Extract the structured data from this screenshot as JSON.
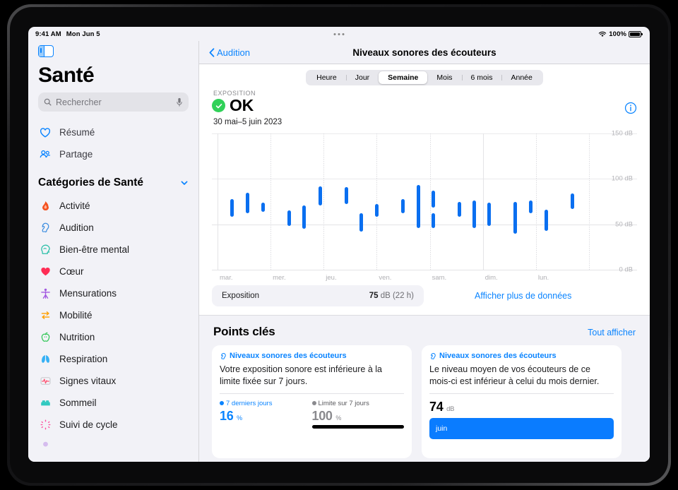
{
  "status_bar": {
    "time": "9:41 AM",
    "date": "Mon Jun 5",
    "battery_percent": "100%",
    "wifi_icon": "wifi-icon",
    "battery_icon": "battery-icon"
  },
  "sidebar": {
    "toggle_icon": "sidebar-toggle-icon",
    "app_title": "Santé",
    "search": {
      "placeholder": "Rechercher",
      "value": "",
      "search_icon": "search-icon",
      "mic_icon": "microphone-icon"
    },
    "top_items": [
      {
        "label": "Résumé",
        "icon": "heart-outline-icon",
        "color": "#0a84ff"
      },
      {
        "label": "Partage",
        "icon": "people-icon",
        "color": "#0a84ff"
      }
    ],
    "section": {
      "label": "Catégories de Santé",
      "chevron_icon": "chevron-down-icon"
    },
    "categories": [
      {
        "label": "Activité",
        "icon": "flame-icon",
        "color": "#f4511e"
      },
      {
        "label": "Audition",
        "icon": "ear-icon",
        "color": "#3f8fe0"
      },
      {
        "label": "Bien-être mental",
        "icon": "head-icon",
        "color": "#2bbfa8"
      },
      {
        "label": "Cœur",
        "icon": "heart-filled-icon",
        "color": "#ff2d55"
      },
      {
        "label": "Mensurations",
        "icon": "body-icon",
        "color": "#a259e0"
      },
      {
        "label": "Mobilité",
        "icon": "arrows-icon",
        "color": "#ffa000"
      },
      {
        "label": "Nutrition",
        "icon": "apple-icon",
        "color": "#34c759"
      },
      {
        "label": "Respiration",
        "icon": "lungs-icon",
        "color": "#35b0f5"
      },
      {
        "label": "Signes vitaux",
        "icon": "vitals-icon",
        "color": "#ff4d6d"
      },
      {
        "label": "Sommeil",
        "icon": "bed-icon",
        "color": "#30c9c0"
      },
      {
        "label": "Suivi de cycle",
        "icon": "cycle-icon",
        "color": "#ff4d9e"
      }
    ]
  },
  "nav_bar": {
    "back_label": "Audition",
    "back_icon": "chevron-left-icon",
    "title": "Niveaux sonores des écouteurs"
  },
  "segmented_control": {
    "options": [
      "Heure",
      "Jour",
      "Semaine",
      "Mois",
      "6 mois",
      "Année"
    ],
    "selected": "Semaine"
  },
  "exposure": {
    "section_label": "EXPOSITION",
    "status": "OK",
    "status_icon": "checkmark-circle-icon",
    "status_color": "#30d158",
    "date_range": "30 mai–5 juin 2023",
    "info_icon": "info-circle-icon"
  },
  "chart_data": {
    "type": "bar",
    "title": "Niveaux sonores des écouteurs",
    "subtitle": "30 mai–5 juin 2023",
    "xlabel": "",
    "ylabel": "dB",
    "ylim": [
      0,
      150
    ],
    "yticks": [
      0,
      50,
      100,
      150
    ],
    "ytick_labels": [
      "0 dB",
      "50 dB",
      "100 dB",
      "150 dB"
    ],
    "categories": [
      "mar.",
      "mer.",
      "jeu.",
      "ven.",
      "sam.",
      "dim.",
      "lun."
    ],
    "grid": true,
    "legend": "none",
    "series_note": "Each day shows several floating range bars (min–max dB).",
    "bars": [
      {
        "day": "mar.",
        "x_frac": 0.04,
        "low": 58,
        "high": 78
      },
      {
        "day": "mar.",
        "x_frac": 0.09,
        "low": 62,
        "high": 85
      },
      {
        "day": "mar.",
        "x_frac": 0.138,
        "low": 64,
        "high": 74
      },
      {
        "day": "mer.",
        "x_frac": 0.222,
        "low": 48,
        "high": 65
      },
      {
        "day": "mer.",
        "x_frac": 0.27,
        "low": 45,
        "high": 71
      },
      {
        "day": "mer.",
        "x_frac": 0.32,
        "low": 71,
        "high": 92
      },
      {
        "day": "jeu.",
        "x_frac": 0.403,
        "low": 72,
        "high": 91
      },
      {
        "day": "jeu.",
        "x_frac": 0.452,
        "low": 42,
        "high": 62
      },
      {
        "day": "jeu.",
        "x_frac": 0.5,
        "low": 58,
        "high": 72
      },
      {
        "day": "ven.",
        "x_frac": 0.583,
        "low": 62,
        "high": 78
      },
      {
        "day": "ven.",
        "x_frac": 0.632,
        "low": 46,
        "high": 93
      },
      {
        "day": "ven.",
        "x_frac": 0.68,
        "low": 68,
        "high": 87
      },
      {
        "day": "ven.",
        "x_frac": 0.68,
        "low": 46,
        "high": 62
      },
      {
        "day": "sam.",
        "x_frac": 0.762,
        "low": 58,
        "high": 75
      },
      {
        "day": "sam.",
        "x_frac": 0.81,
        "low": 46,
        "high": 76
      },
      {
        "day": "sam.",
        "x_frac": 0.858,
        "low": 48,
        "high": 74
      },
      {
        "day": "dim.",
        "x_frac": 0.941,
        "low": 40,
        "high": 75
      },
      {
        "day": "dim.",
        "x_frac": 0.99,
        "low": 62,
        "high": 76
      },
      {
        "day": "lun.",
        "x_frac": 1.038,
        "low": 43,
        "high": 66
      },
      {
        "day": "lun.",
        "x_frac": 1.121,
        "low": 67,
        "high": 84
      }
    ]
  },
  "exposition_summary": {
    "label": "Exposition",
    "value_number": "75",
    "value_unit": " dB (22 h)",
    "show_more_label": "Afficher plus de données"
  },
  "key_points": {
    "title": "Points clés",
    "see_all_label": "Tout afficher",
    "cards": [
      {
        "category": "Niveaux sonores des écouteurs",
        "category_icon": "ear-icon",
        "body": "Votre exposition sonore est inférieure à la limite fixée sur 7 jours.",
        "legends": [
          {
            "label": "7 derniers jours",
            "dot_color": "#0a84ff",
            "value": "16",
            "unit": "%",
            "value_color": "#0a84ff"
          },
          {
            "label": "Limite sur 7 jours",
            "dot_color": "#8a8a8e",
            "value": "100",
            "unit": "%",
            "value_color": "#8a8a8e"
          }
        ]
      },
      {
        "category": "Niveaux sonores des écouteurs",
        "category_icon": "ear-icon",
        "body": "Le niveau moyen de vos écouteurs de ce mois-ci est inférieur à celui du mois dernier.",
        "big_value": "74",
        "big_unit": "dB",
        "month_label": "juin",
        "month_bar_color": "#0a7cff"
      }
    ]
  }
}
